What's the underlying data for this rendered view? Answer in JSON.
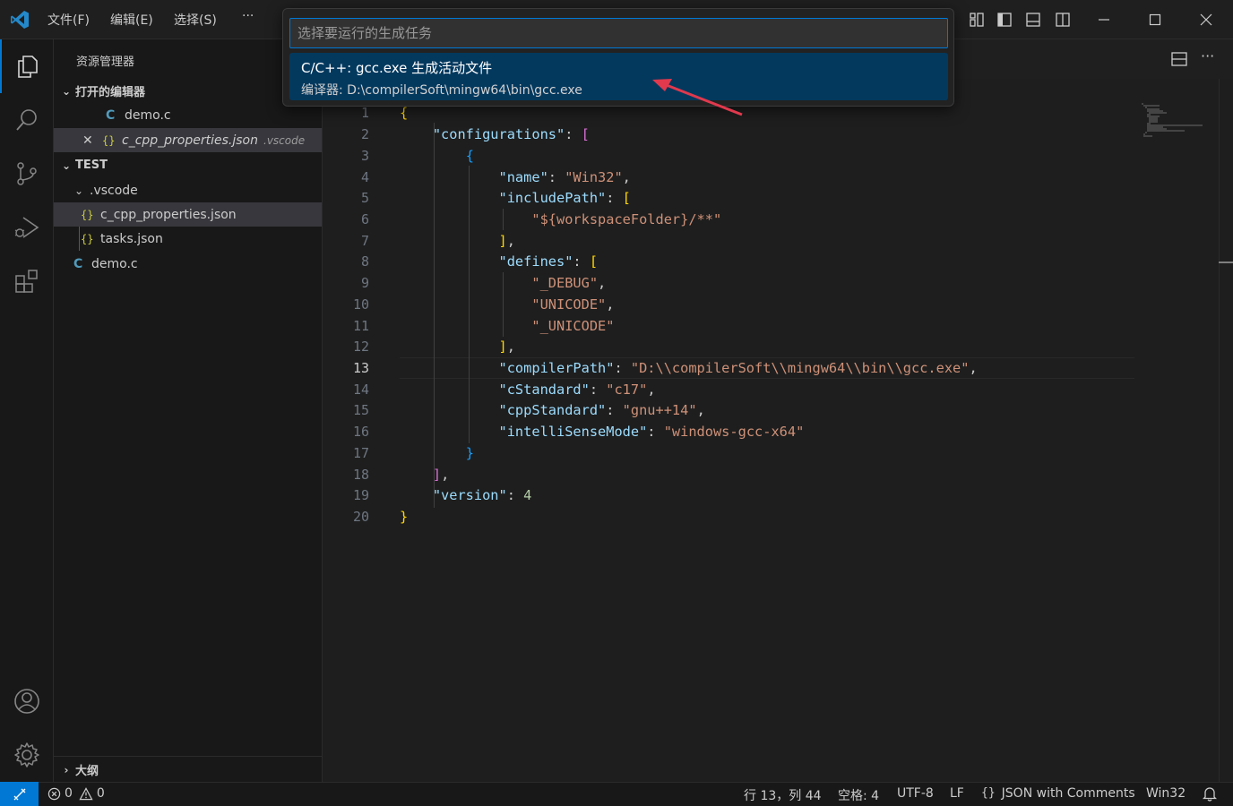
{
  "titlebar": {
    "menu": [
      "文件(F)",
      "编辑(E)",
      "选择(S)",
      "···"
    ]
  },
  "sidebar": {
    "title": "资源管理器",
    "open_editors": {
      "header": "打开的编辑器",
      "items": [
        {
          "icon": "C",
          "name": "demo.c",
          "suffix": ""
        },
        {
          "icon": "{}",
          "name": "c_cpp_properties.json",
          "suffix": ".vscode",
          "close": "✕"
        }
      ]
    },
    "workspace": {
      "header": "TEST",
      "folder": ".vscode",
      "items": [
        {
          "icon": "{}",
          "name": "c_cpp_properties.json"
        },
        {
          "icon": "{}",
          "name": "tasks.json"
        },
        {
          "icon": "C",
          "name": "demo.c"
        }
      ]
    },
    "outline": "大纲"
  },
  "quickpick": {
    "placeholder": "选择要运行的生成任务",
    "item_label": "C/C++: gcc.exe 生成活动文件",
    "item_detail": "编译器: D:\\compilerSoft\\mingw64\\bin\\gcc.exe"
  },
  "editor": {
    "line_numbers": [
      "1",
      "2",
      "3",
      "4",
      "5",
      "6",
      "7",
      "8",
      "9",
      "10",
      "11",
      "12",
      "13",
      "14",
      "15",
      "16",
      "17",
      "18",
      "19",
      "20"
    ],
    "current_line": 13
  },
  "statusbar": {
    "errors": "0",
    "warnings": "0",
    "position": "行 13，列 44",
    "spaces": "空格: 4",
    "encoding": "UTF-8",
    "eol": "LF",
    "language": "JSON with Comments",
    "config": "Win32"
  },
  "colors": {
    "accent": "#0078d4",
    "selection": "#04395e"
  }
}
